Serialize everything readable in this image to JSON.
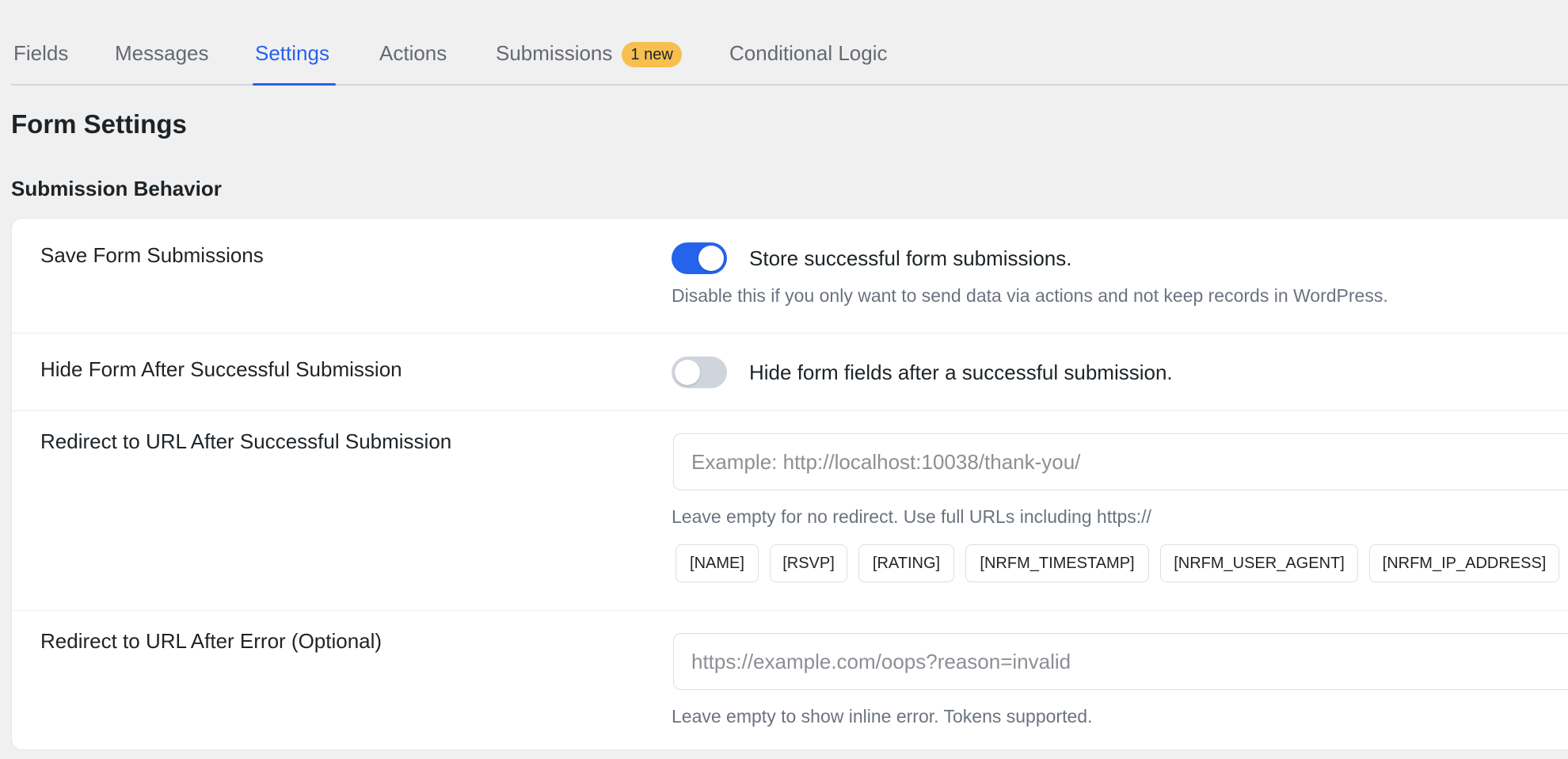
{
  "tabs": [
    {
      "label": "Fields"
    },
    {
      "label": "Messages"
    },
    {
      "label": "Settings"
    },
    {
      "label": "Actions"
    },
    {
      "label": "Submissions",
      "badge": "1 new"
    },
    {
      "label": "Conditional Logic"
    }
  ],
  "active_tab": "Settings",
  "page_title": "Form Settings",
  "section_title": "Submission Behavior",
  "settings": {
    "save_submissions": {
      "label": "Save Form Submissions",
      "toggle_on": true,
      "toggle_label": "Store successful form submissions.",
      "hint": "Disable this if you only want to send data via actions and not keep records in WordPress."
    },
    "hide_form": {
      "label": "Hide Form After Successful Submission",
      "toggle_on": false,
      "toggle_label": "Hide form fields after a successful submission."
    },
    "redirect_success": {
      "label": "Redirect to URL After Successful Submission",
      "value": "",
      "placeholder": "Example: http://localhost:10038/thank-you/",
      "hint": "Leave empty for no redirect. Use full URLs including https://",
      "tokens": [
        "[NAME]",
        "[RSVP]",
        "[RATING]",
        "[NRFM_TIMESTAMP]",
        "[NRFM_USER_AGENT]",
        "[NRFM_IP_ADDRESS]"
      ]
    },
    "redirect_error": {
      "label": "Redirect to URL After Error (Optional)",
      "value": "",
      "placeholder": "https://example.com/oops?reason=invalid",
      "hint": "Leave empty to show inline error. Tokens supported."
    }
  },
  "colors": {
    "accent": "#2563eb",
    "badge": "#f6bf4f",
    "background": "#f0f0f1",
    "toggle_off": "#d0d5dd"
  }
}
